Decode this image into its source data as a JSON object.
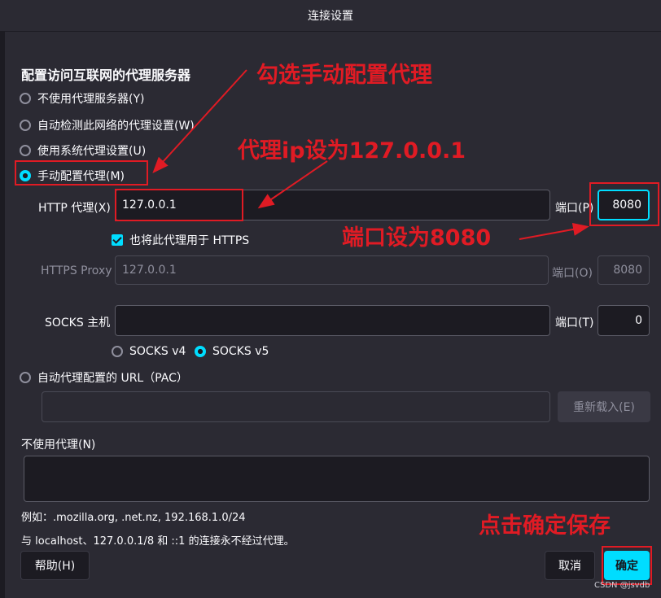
{
  "window": {
    "title": "连接设置"
  },
  "heading": "配置访问互联网的代理服务器",
  "proxy_modes": [
    {
      "label": "不使用代理服务器(Y)",
      "selected": false
    },
    {
      "label": "自动检测此网络的代理设置(W)",
      "selected": false
    },
    {
      "label": "使用系统代理设置(U)",
      "selected": false
    },
    {
      "label": "手动配置代理(M)",
      "selected": true
    }
  ],
  "http": {
    "label": "HTTP 代理(X)",
    "host": "127.0.0.1",
    "port_label": "端口(P)",
    "port": "8080"
  },
  "use_for_https": {
    "label": "也将此代理用于 HTTPS",
    "checked": true
  },
  "https": {
    "label": "HTTPS Proxy",
    "host": "127.0.0.1",
    "port_label": "端口(O)",
    "port": "8080"
  },
  "socks": {
    "label": "SOCKS 主机",
    "host": "",
    "port_label": "端口(T)",
    "port": "0",
    "v4": "SOCKS v4",
    "v5": "SOCKS v5",
    "selected": "v5"
  },
  "pac": {
    "label": "自动代理配置的 URL（PAC）",
    "url": "",
    "reload_label": "重新载入(E)"
  },
  "no_proxy": {
    "label": "不使用代理(N)",
    "value": "",
    "example": "例如：.mozilla.org, .net.nz, 192.168.1.0/24",
    "note": "与 localhost、127.0.0.1/8 和 ::1 的连接永不经过代理。"
  },
  "buttons": {
    "help": "帮助(H)",
    "cancel": "取消",
    "ok": "确定"
  },
  "annotations": {
    "manual": "勾选手动配置代理",
    "ip": "代理ip设为127.0.0.1",
    "port": "端口设为8080",
    "ok": "点击确定保存"
  },
  "watermark": "CSDN @jsvdb",
  "colors": {
    "accent": "#00ddff",
    "background": "#2b2a33",
    "field": "#1c1b22",
    "annotation": "#e01b24"
  }
}
